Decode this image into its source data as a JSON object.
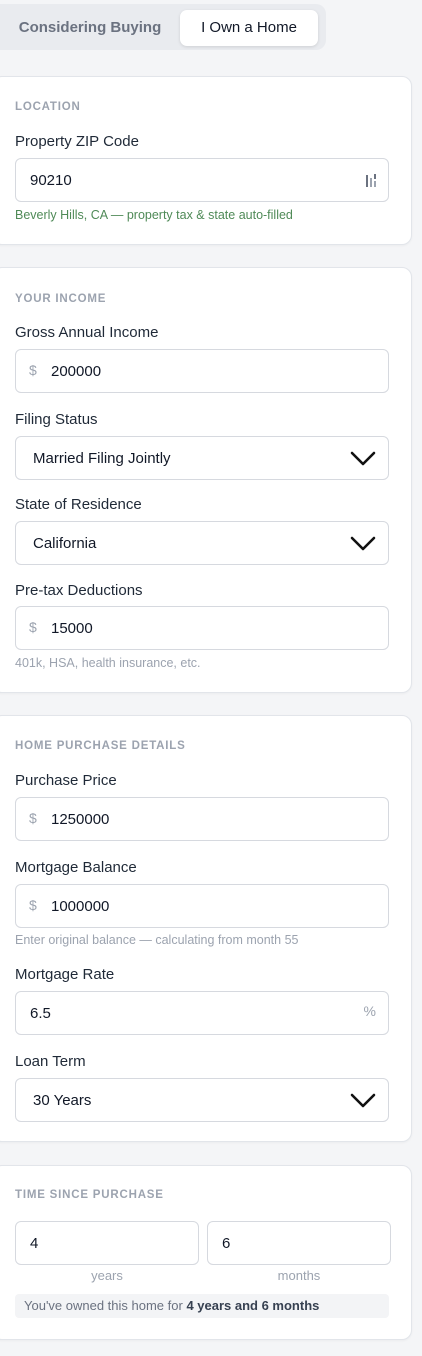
{
  "tabs": {
    "considering": "Considering Buying",
    "own": "I Own a Home"
  },
  "location": {
    "section": "LOCATION",
    "zip_label": "Property ZIP Code",
    "zip_value": "90210",
    "zip_hint": "Beverly Hills, CA — property tax & state auto-filled"
  },
  "income": {
    "section": "YOUR INCOME",
    "gross_label": "Gross Annual Income",
    "gross_prefix": "$",
    "gross_value": "200000",
    "filing_label": "Filing Status",
    "filing_value": "Married Filing Jointly",
    "state_label": "State of Residence",
    "state_value": "California",
    "pretax_label": "Pre-tax Deductions",
    "pretax_prefix": "$",
    "pretax_value": "15000",
    "pretax_hint": "401k, HSA, health insurance, etc."
  },
  "home": {
    "section": "HOME PURCHASE DETAILS",
    "price_label": "Purchase Price",
    "price_prefix": "$",
    "price_value": "1250000",
    "balance_label": "Mortgage Balance",
    "balance_prefix": "$",
    "balance_value": "1000000",
    "balance_hint": "Enter original balance — calculating from month 55",
    "rate_label": "Mortgage Rate",
    "rate_value": "6.5",
    "rate_suffix": "%",
    "term_label": "Loan Term",
    "term_value": "30 Years"
  },
  "time": {
    "section": "TIME SINCE PURCHASE",
    "years_value": "4",
    "months_value": "6",
    "years_unit": "years",
    "months_unit": "months",
    "summary_prefix": "You've owned this home for ",
    "summary_bold": "4 years and 6 months"
  },
  "colors": {
    "accent_green": "#4f8a57",
    "muted": "#9ca3af"
  },
  "icons": {
    "zip_field": "password-manager-icon",
    "select": "chevron-down-icon"
  }
}
